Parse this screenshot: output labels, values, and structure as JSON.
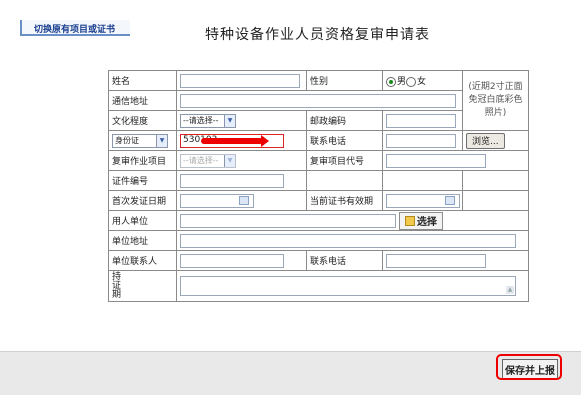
{
  "header": {
    "switch_label": "切换原有项目或证书",
    "title": "特种设备作业人员资格复审申请表"
  },
  "form": {
    "name_label": "姓名",
    "gender_label": "性别",
    "gender_male": "男",
    "gender_female": "女",
    "address_label": "通信地址",
    "photo_hint": "(近期2寸正面免冠白底彩色照片)",
    "education_label": "文化程度",
    "education_select": "--请选择--",
    "zip_label": "邮政编码",
    "id_type_select": "身份证",
    "id_number_value": "530103",
    "phone_label": "联系电话",
    "browse_button": "浏览...",
    "review_item_label": "复审作业项目",
    "review_item_select": "--请选择--",
    "review_code_label": "复审项目代号",
    "cert_no_label": "证件编号",
    "first_issue_label": "首次发证日期",
    "cert_valid_label": "当前证书有效期",
    "employer_label": "用人单位",
    "choose_button": "选择",
    "unit_address_label": "单位地址",
    "unit_contact_label": "单位联系人",
    "unit_phone_label": "联系电话",
    "holding_label": "持证期"
  },
  "footer": {
    "submit_button": "保存并上报"
  }
}
